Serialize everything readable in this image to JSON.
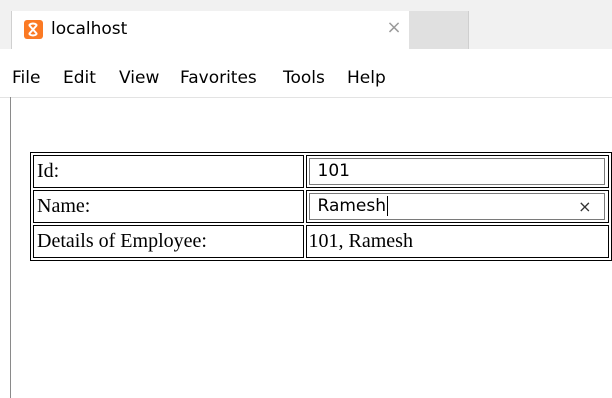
{
  "browser": {
    "tab_title": "localhost",
    "tab_close": "×",
    "icon": "xampp-logo-icon",
    "accent": "#fb7a24"
  },
  "menu": [
    "File",
    "Edit",
    "View",
    "Favorites",
    "Tools",
    "Help"
  ],
  "form": {
    "id_label": "Id:",
    "id_value": "101",
    "name_label": "Name:",
    "name_value": "Ramesh",
    "name_clear": "×",
    "details_label": "Details of Employee:",
    "details_value": "101, Ramesh"
  }
}
